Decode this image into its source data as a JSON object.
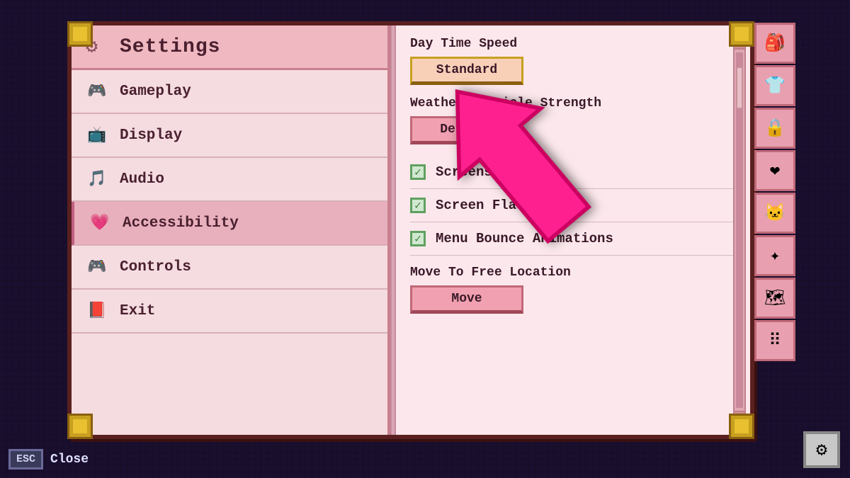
{
  "page": {
    "background_color": "#1a0f2e"
  },
  "header": {
    "title": "Settings",
    "gear_icon": "⚙"
  },
  "nav": {
    "items": [
      {
        "id": "gameplay",
        "label": "Gameplay",
        "icon": "🎮",
        "active": false
      },
      {
        "id": "display",
        "label": "Display",
        "icon": "📺",
        "active": false
      },
      {
        "id": "audio",
        "label": "Audio",
        "icon": "🎵",
        "active": false
      },
      {
        "id": "accessibility",
        "label": "Accessibility",
        "icon": "💗",
        "active": true
      },
      {
        "id": "controls",
        "label": "Controls",
        "icon": "🎮",
        "active": false
      },
      {
        "id": "exit",
        "label": "Exit",
        "icon": "📕",
        "active": false
      }
    ]
  },
  "right_panel": {
    "sections": [
      {
        "id": "day-time-speed",
        "label": "Day Time Speed",
        "type": "button",
        "value": "Standard",
        "highlighted": true
      },
      {
        "id": "weather-particles",
        "label": "Weather Particle Strength",
        "type": "button",
        "value": "Default",
        "highlighted": false
      },
      {
        "id": "screenshake",
        "label": "Screenshake",
        "type": "checkbox",
        "checked": true
      },
      {
        "id": "screen-flash",
        "label": "Screen Flash",
        "type": "checkbox",
        "checked": true
      },
      {
        "id": "menu-bounce",
        "label": "Menu Bounce Animations",
        "type": "checkbox",
        "checked": true
      },
      {
        "id": "move-to-free",
        "label": "Move To Free Location",
        "type": "button",
        "value": "Move",
        "highlighted": false
      }
    ]
  },
  "sidebar_icons": [
    {
      "id": "bag",
      "icon": "🎒"
    },
    {
      "id": "shirt",
      "icon": "👕"
    },
    {
      "id": "lock",
      "icon": "🔒"
    },
    {
      "id": "heart",
      "icon": "❤"
    },
    {
      "id": "face",
      "icon": "🐱"
    },
    {
      "id": "star",
      "icon": "✦"
    },
    {
      "id": "map",
      "icon": "🗺"
    },
    {
      "id": "menu",
      "icon": "⠿"
    }
  ],
  "bottom_gear_icon": "⚙",
  "esc": {
    "badge": "ESC",
    "label": "Close"
  }
}
